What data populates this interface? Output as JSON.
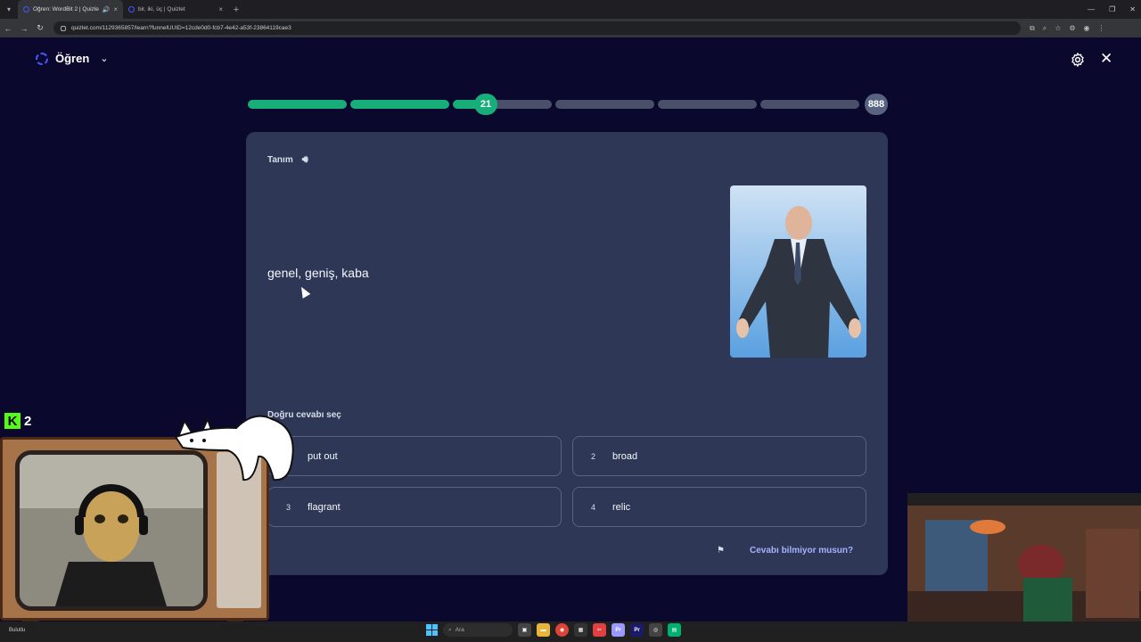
{
  "browser": {
    "tabs": [
      {
        "title": "Öğren: WordBit 2 | Quizlet",
        "active": true
      },
      {
        "title": "bir, iki, üç | Quizlet",
        "active": false
      }
    ],
    "url": "quizlet.com/1129365857/learn?funnelUUID=12cde0d0-fcb7-4e42-a53f-23864119cae3"
  },
  "header": {
    "mode_label": "Öğren"
  },
  "progress": {
    "segments_fill": [
      1,
      1,
      0.35,
      0,
      0,
      0
    ],
    "current": "21",
    "total": "888"
  },
  "card": {
    "term_label": "Tanım",
    "prompt": "genel, geniş, kaba",
    "choose_label": "Doğru cevabı seç",
    "options": [
      {
        "num": "1",
        "text": "put out"
      },
      {
        "num": "2",
        "text": "broad"
      },
      {
        "num": "3",
        "text": "flagrant"
      },
      {
        "num": "4",
        "text": "relic"
      }
    ],
    "dont_know": "Cevabı bilmiyor musun?"
  },
  "overlay": {
    "kick_viewers": "2"
  },
  "taskbar": {
    "search_placeholder": "Ara",
    "left_text": "Bulutlu"
  },
  "colors": {
    "background": "#0a092d",
    "card": "#2e3856",
    "progress_green": "#18ae79",
    "accent_link": "#a8b1ff"
  }
}
